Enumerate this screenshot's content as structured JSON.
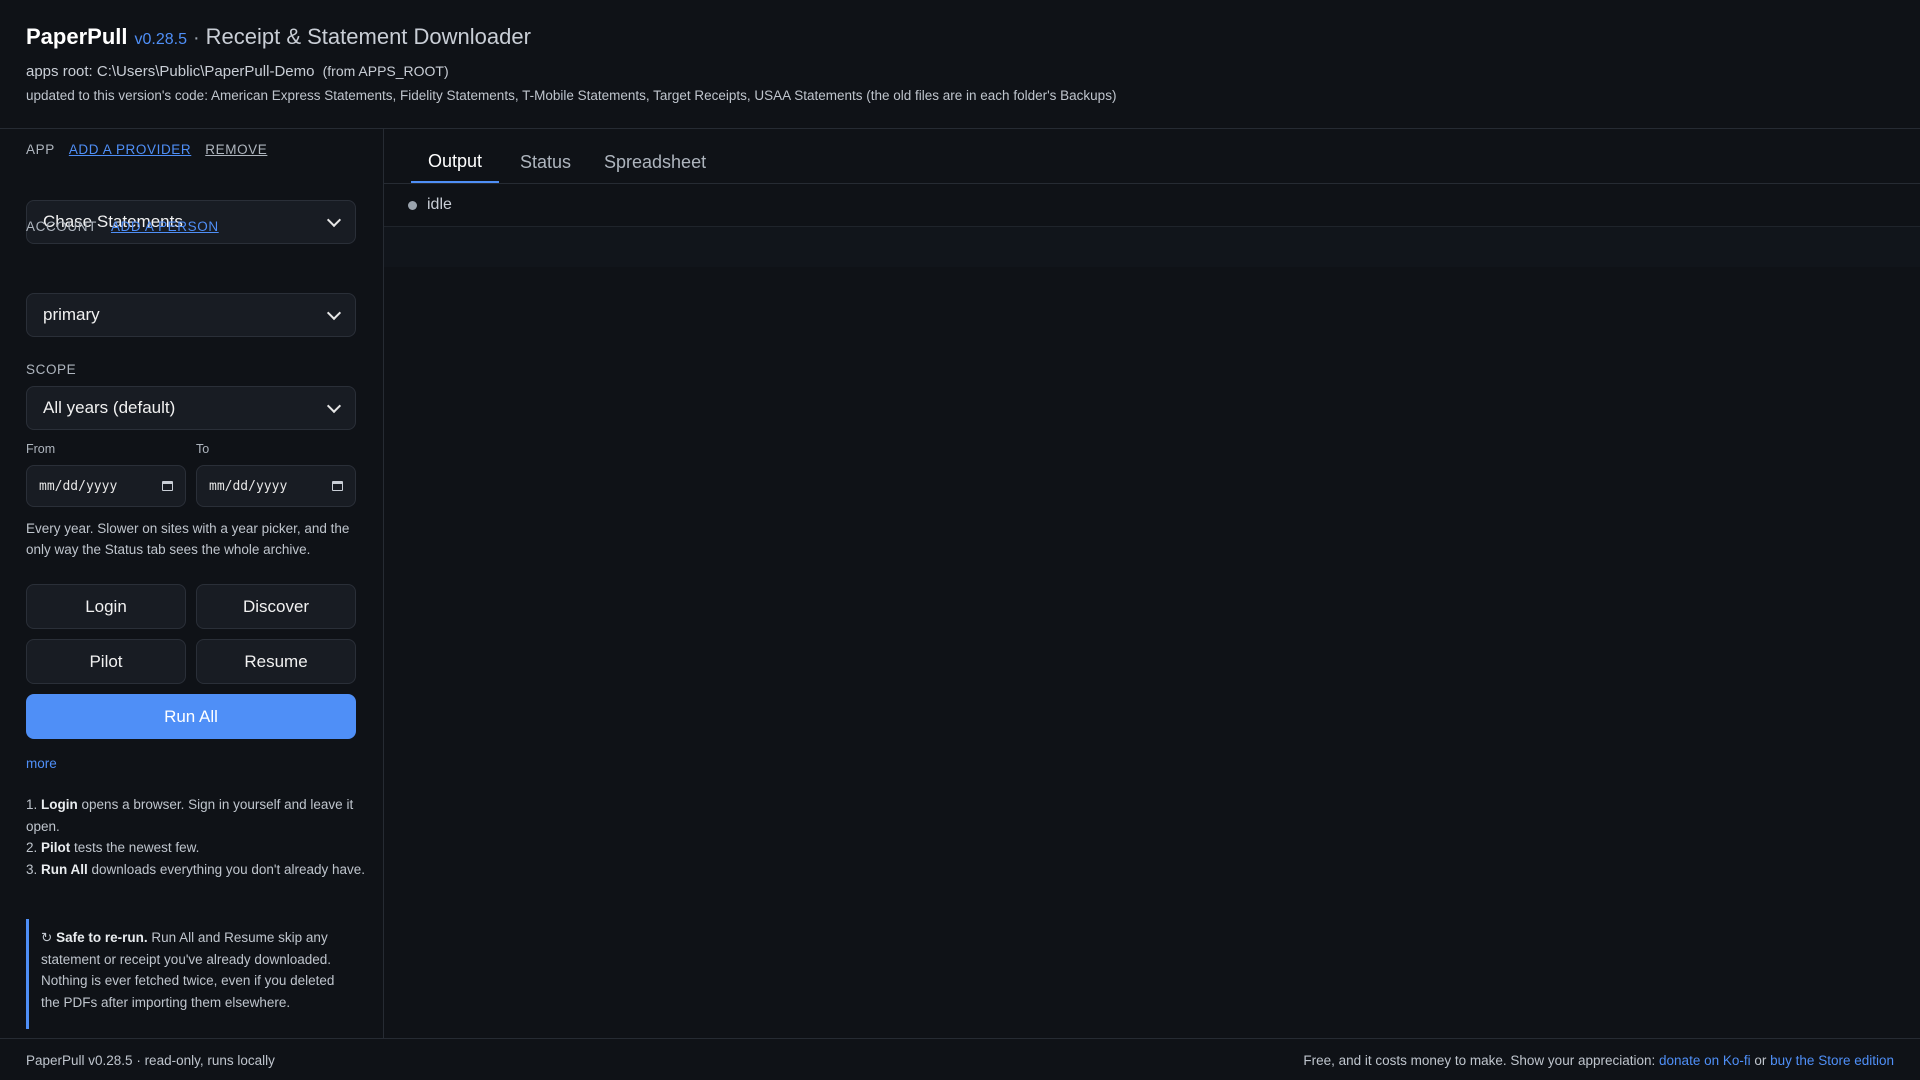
{
  "header": {
    "brand": "PaperPull",
    "version": "v0.28.5",
    "separator": "·",
    "subtitle": "Receipt & Statement Downloader",
    "apps_root_label": "apps root: C:\\Users\\Public\\PaperPull-Demo",
    "apps_root_source": "(from APPS_ROOT)",
    "updated_line": "updated to this version's code: American Express Statements, Fidelity Statements, T-Mobile Statements, Target Receipts, USAA Statements (the old files are in each folder's Backups)"
  },
  "sidebar": {
    "app_label": "APP",
    "add_provider": "ADD A PROVIDER",
    "remove": "REMOVE",
    "app_value": "Chase Statements",
    "account_label": "ACCOUNT",
    "add_person": "ADD A PERSON",
    "account_value": "primary",
    "scope_label": "SCOPE",
    "scope_value": "All years (default)",
    "from_label": "From",
    "to_label": "To",
    "date_placeholder": "mm/dd/yyyy",
    "scope_note": "Every year. Slower on sites with a year picker, and the only way the Status tab sees the whole archive.",
    "buttons": {
      "login": "Login",
      "discover": "Discover",
      "pilot": "Pilot",
      "resume": "Resume",
      "run_all": "Run All"
    },
    "more": "more",
    "steps": [
      {
        "num": "1.",
        "bold": "Login",
        "text": " opens a browser. Sign in yourself and leave it open."
      },
      {
        "num": "2.",
        "bold": "Pilot",
        "text": " tests the newest few."
      },
      {
        "num": "3.",
        "bold": "Run All",
        "text": " downloads everything you don't already have."
      }
    ],
    "callout": {
      "glyph": "↻",
      "bold": "Safe to re-run.",
      "text": " Run All and Resume skip any statement or receipt you've already downloaded. Nothing is ever fetched twice, even if you deleted the PDFs after importing them elsewhere."
    }
  },
  "main": {
    "tabs": [
      "Output",
      "Status",
      "Spreadsheet"
    ],
    "active_tab": "Output",
    "status": "idle"
  },
  "footer": {
    "left": "PaperPull v0.28.5 · read-only, runs locally",
    "right_text": "Free, and it costs money to make. Show your appreciation:",
    "kofi": "donate on Ko-fi",
    "or": "or",
    "store": "buy the Store edition"
  },
  "colors": {
    "accent": "#4f8ff7",
    "background": "#0f1217",
    "panel": "#181c23"
  }
}
